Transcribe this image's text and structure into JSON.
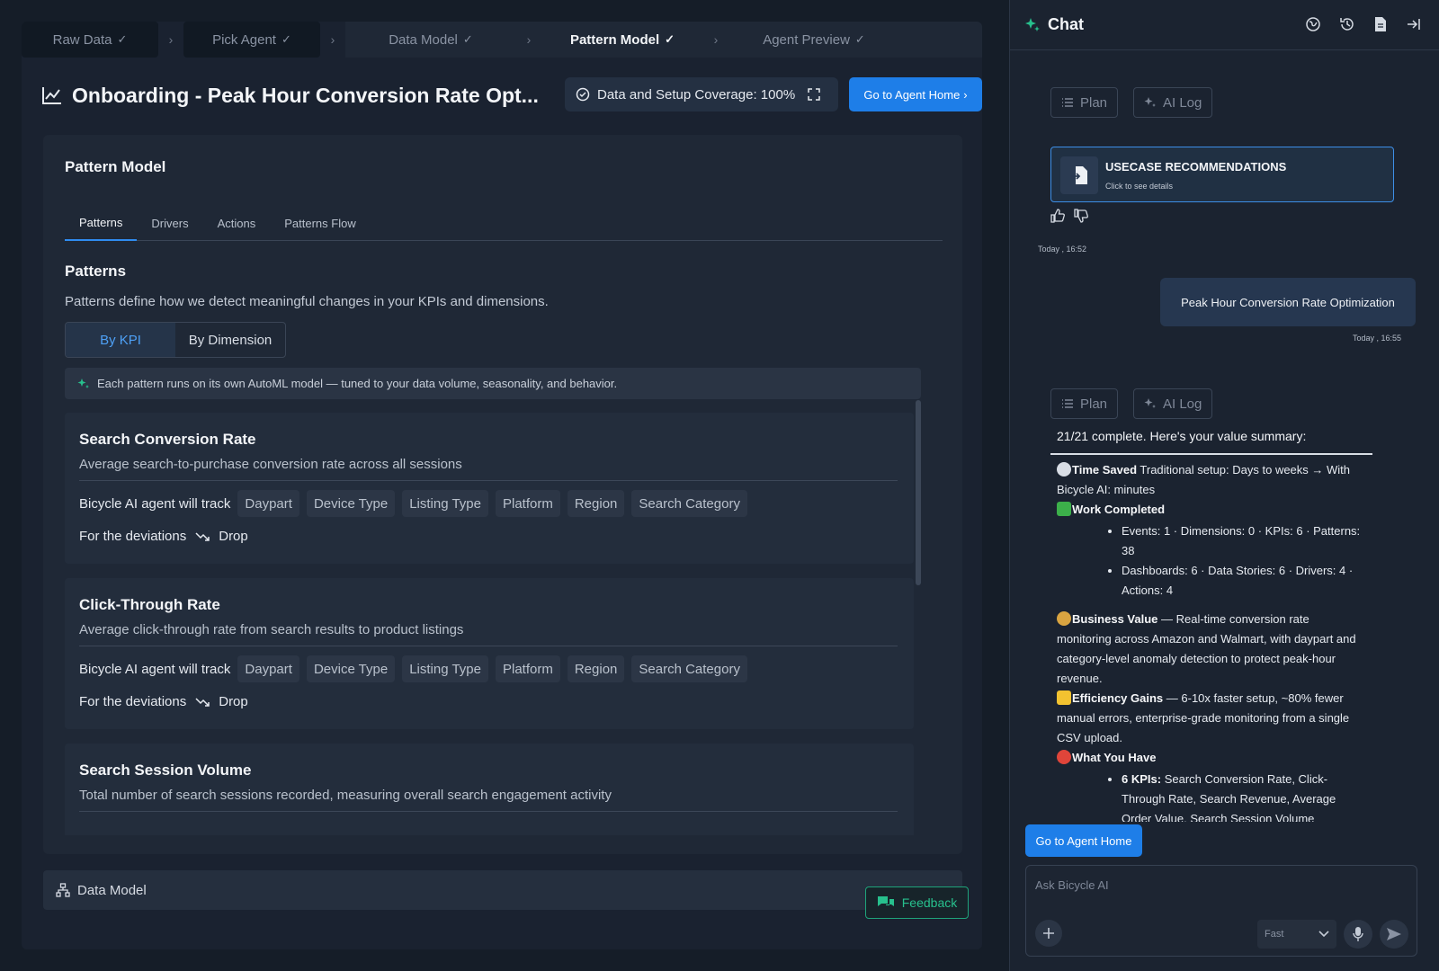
{
  "stepper": {
    "steps": [
      {
        "label": "Raw Data"
      },
      {
        "label": "Pick Agent"
      },
      {
        "label": "Data Model"
      },
      {
        "label": "Pattern Model"
      },
      {
        "label": "Agent Preview"
      }
    ],
    "check": "✓",
    "sep": "›"
  },
  "header": {
    "title": "Onboarding - Peak Hour Conversion Rate Opt...",
    "coverage": "Data and Setup Coverage: 100%",
    "go_home": "Go to Agent Home"
  },
  "pattern_model": {
    "title": "Pattern Model",
    "tabs": [
      "Patterns",
      "Drivers",
      "Actions",
      "Patterns Flow"
    ],
    "section_title": "Patterns",
    "section_desc": "Patterns define how we detect meaningful changes in your KPIs and dimensions.",
    "toggle": [
      "By KPI",
      "By Dimension"
    ],
    "note": "Each pattern runs on its own AutoML model — tuned to your data volume, seasonality, and behavior.",
    "track_label": "Bicycle AI agent will track",
    "deviation_label": "For the deviations",
    "kpis": [
      {
        "title": "Search Conversion Rate",
        "desc": "Average search-to-purchase conversion rate across all sessions",
        "dims": [
          "Daypart",
          "Device Type",
          "Listing Type",
          "Platform",
          "Region",
          "Search Category"
        ],
        "deviation": "Drop"
      },
      {
        "title": "Click-Through Rate",
        "desc": "Average click-through rate from search results to product listings",
        "dims": [
          "Daypart",
          "Device Type",
          "Listing Type",
          "Platform",
          "Region",
          "Search Category"
        ],
        "deviation": "Drop"
      },
      {
        "title": "Search Session Volume",
        "desc": "Total number of search sessions recorded, measuring overall search engagement activity"
      }
    ]
  },
  "data_model_bar": "Data Model",
  "feedback": "Feedback",
  "chat": {
    "title": "Chat",
    "plan": "Plan",
    "ai_log": "AI Log",
    "usecase_title": "USECASE RECOMMENDATIONS",
    "usecase_sub": "Click to see details",
    "ts1": "Today , 16:52",
    "user_msg": "Peak Hour Conversion Rate Optimization",
    "ts2": "Today , 16:55",
    "summary_head": "21/21 complete. Here's your value summary:",
    "time_saved_label": "Time Saved",
    "time_saved_text": " Traditional setup: Days to weeks → With Bicycle AI: minutes",
    "work_completed_label": "Work Completed",
    "work_items": [
      "Events: 1 · Dimensions: 0 · KPIs: 6 · Patterns: 38",
      "Dashboards: 6 · Data Stories: 6 · Drivers: 4 · Actions: 4"
    ],
    "business_value_label": "Business Value",
    "business_value_text": " — Real-time conversion rate monitoring across Amazon and Walmart, with daypart and category-level anomaly detection to protect peak-hour revenue.",
    "efficiency_label": "Efficiency Gains",
    "efficiency_text": " — 6-10x faster setup, ~80% fewer manual errors, enterprise-grade monitoring from a single CSV upload.",
    "what_you_have_label": "What You Have",
    "kpis_label": "6 KPIs:",
    "kpis_text": " Search Conversion Rate, Click-Through Rate, Search Revenue, Average Order Value, Search Session Volume",
    "go_home": "Go to Agent Home",
    "input_placeholder": "Ask Bicycle AI",
    "speed": "Fast"
  },
  "colors": {
    "accent": "#1e7ee8",
    "success": "#27c08d",
    "active_tab": "#2f8cf0"
  }
}
